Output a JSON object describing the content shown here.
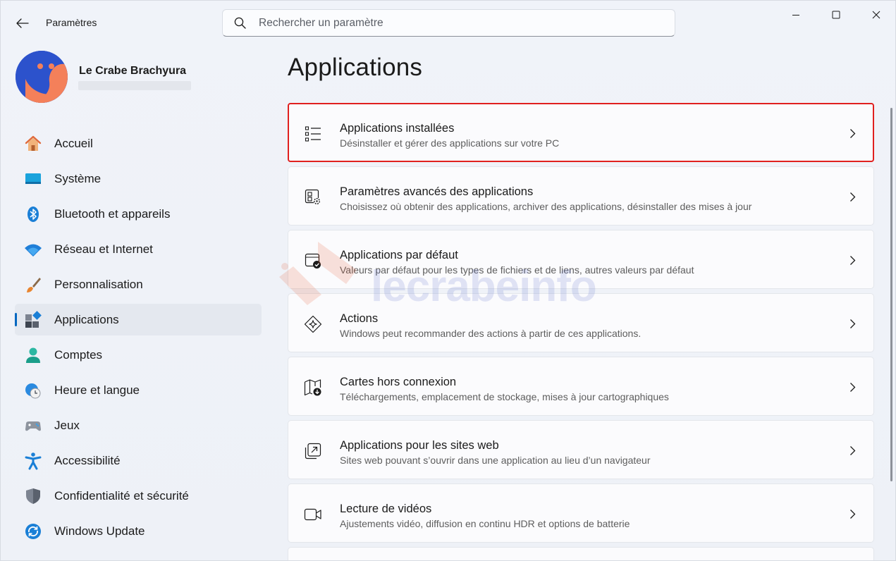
{
  "window": {
    "title": "Paramètres"
  },
  "search": {
    "placeholder": "Rechercher un paramètre"
  },
  "profile": {
    "name": "Le Crabe Brachyura"
  },
  "sidebar": {
    "items": [
      {
        "label": "Accueil",
        "icon": "home-icon"
      },
      {
        "label": "Système",
        "icon": "system-icon"
      },
      {
        "label": "Bluetooth et appareils",
        "icon": "bluetooth-icon"
      },
      {
        "label": "Réseau et Internet",
        "icon": "wifi-icon"
      },
      {
        "label": "Personnalisation",
        "icon": "brush-icon"
      },
      {
        "label": "Applications",
        "icon": "apps-icon",
        "active": true
      },
      {
        "label": "Comptes",
        "icon": "account-icon"
      },
      {
        "label": "Heure et langue",
        "icon": "clock-globe-icon"
      },
      {
        "label": "Jeux",
        "icon": "gamepad-icon"
      },
      {
        "label": "Accessibilité",
        "icon": "accessibility-icon"
      },
      {
        "label": "Confidentialité et sécurité",
        "icon": "shield-icon"
      },
      {
        "label": "Windows Update",
        "icon": "update-icon"
      }
    ]
  },
  "main": {
    "title": "Applications",
    "cards": [
      {
        "title": "Applications installées",
        "desc": "Désinstaller et gérer des applications sur votre PC",
        "icon": "installed-apps-list-icon",
        "highlighted": true
      },
      {
        "title": "Paramètres avancés des applications",
        "desc": "Choisissez où obtenir des applications, archiver des applications, désinstaller des mises à jour",
        "icon": "advanced-app-settings-icon"
      },
      {
        "title": "Applications par défaut",
        "desc": "Valeurs par défaut pour les types de fichiers et de liens, autres valeurs par défaut",
        "icon": "default-apps-icon"
      },
      {
        "title": "Actions",
        "desc": "Windows peut recommander des actions à partir de ces applications.",
        "icon": "actions-sparkle-icon"
      },
      {
        "title": "Cartes hors connexion",
        "desc": "Téléchargements, emplacement de stockage, mises à jour cartographiques",
        "icon": "offline-maps-icon"
      },
      {
        "title": "Applications pour les sites web",
        "desc": "Sites web pouvant s’ouvrir dans une application au lieu d’un navigateur",
        "icon": "apps-for-websites-icon"
      },
      {
        "title": "Lecture de vidéos",
        "desc": "Ajustements vidéo, diffusion en continu HDR et options de batterie",
        "icon": "video-camera-icon"
      }
    ]
  },
  "watermark": {
    "text": "lecrabeinfo"
  },
  "colors": {
    "accent": "#0067c0",
    "highlight_border": "#e0201f",
    "avatar_blue": "#2c52cc",
    "avatar_orange": "#f4805a"
  }
}
